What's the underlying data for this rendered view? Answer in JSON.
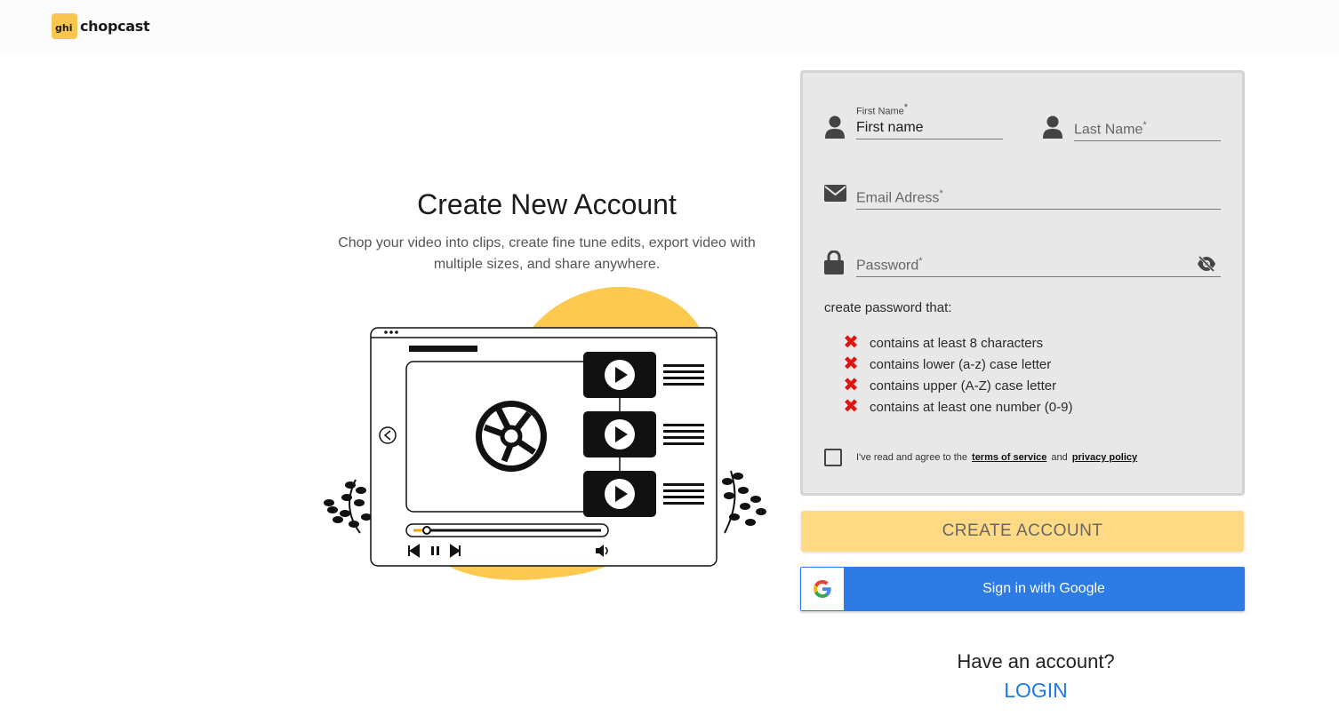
{
  "brand": {
    "name": "chopcast",
    "mark_text": "ghi"
  },
  "hero": {
    "title": "Create New Account",
    "subtitle": "Chop your video into clips, create fine tune edits, export video with multiple sizes, and share anywhere."
  },
  "form": {
    "first_name": {
      "label": "First Name",
      "value": "First name",
      "required_mark": "*"
    },
    "last_name": {
      "placeholder": "Last Name",
      "required_mark": "*"
    },
    "email": {
      "placeholder": "Email Adress",
      "required_mark": "*"
    },
    "password": {
      "placeholder": "Password",
      "required_mark": "*"
    },
    "password_rules_title": "create password that:",
    "password_rules": [
      {
        "text": "contains at least 8 characters",
        "status": "fail"
      },
      {
        "text": "contains lower (a-z) case letter",
        "status": "fail"
      },
      {
        "text": "contains upper (A-Z) case letter",
        "status": "fail"
      },
      {
        "text": "contains at least one number (0-9)",
        "status": "fail"
      }
    ],
    "agree": {
      "prefix": "I've read and agree to the",
      "terms": "terms of service",
      "and": "and",
      "privacy": "privacy policy",
      "checked": false
    }
  },
  "actions": {
    "create_account": "CREATE ACCOUNT",
    "google_signin": "Sign in with Google",
    "have_account": "Have an account?",
    "login": "LOGIN"
  },
  "colors": {
    "accent_yellow": "#ffda85",
    "google_blue": "#2d7be5",
    "error_red": "#e11414",
    "link_blue": "#1d7be5"
  }
}
